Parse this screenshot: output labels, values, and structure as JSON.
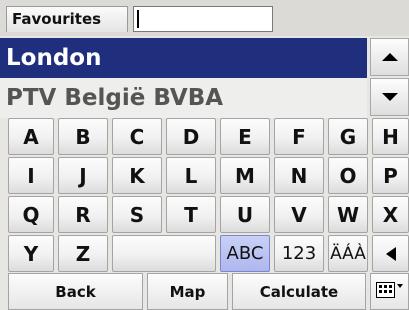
{
  "favourites": {
    "label": "Favourites",
    "value": ""
  },
  "results": [
    {
      "text": "London",
      "selected": true
    },
    {
      "text": "PTV België BVBA",
      "selected": false
    }
  ],
  "keys": [
    "A",
    "B",
    "C",
    "D",
    "E",
    "F",
    "G",
    "H",
    "I",
    "J",
    "K",
    "L",
    "M",
    "N",
    "O",
    "P",
    "Q",
    "R",
    "S",
    "T",
    "U",
    "V",
    "W",
    "X",
    "Y",
    "Z"
  ],
  "modes": {
    "abc": "ABC",
    "num": "123",
    "accent": "ÄÁÀ",
    "active": "abc"
  },
  "bottom": {
    "back": "Back",
    "map": "Map",
    "calculate": "Calculate"
  },
  "icons": {
    "scroll_up": "up-arrow-icon",
    "scroll_down": "down-arrow-icon",
    "backspace": "left-arrow-icon",
    "keyboard": "keyboard-icon"
  }
}
